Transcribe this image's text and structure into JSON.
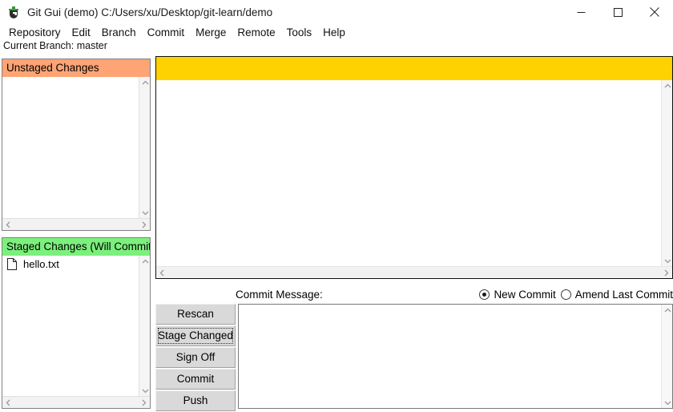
{
  "window": {
    "title": "Git Gui (demo) C:/Users/xu/Desktop/git-learn/demo",
    "icon": "git-gui-icon",
    "controls": {
      "minimize": "minimize-icon",
      "maximize": "maximize-icon",
      "close": "close-icon"
    }
  },
  "menubar": {
    "items": [
      {
        "label": "Repository"
      },
      {
        "label": "Edit"
      },
      {
        "label": "Branch"
      },
      {
        "label": "Commit"
      },
      {
        "label": "Merge"
      },
      {
        "label": "Remote"
      },
      {
        "label": "Tools"
      },
      {
        "label": "Help"
      }
    ]
  },
  "branch_bar": {
    "text": "Current Branch: master"
  },
  "unstaged": {
    "header": "Unstaged Changes",
    "header_color": "#ffa474",
    "files": []
  },
  "staged": {
    "header": "Staged Changes (Will Commit)",
    "header_color": "#7cf07c",
    "files": [
      {
        "icon": "file-icon",
        "name": "hello.txt"
      }
    ]
  },
  "diff": {
    "banner_color": "#fed100",
    "content": ""
  },
  "commit": {
    "message_label": "Commit Message:",
    "options": [
      {
        "label": "New Commit",
        "selected": true
      },
      {
        "label": "Amend Last Commit",
        "selected": false
      }
    ],
    "message_value": "",
    "message_placeholder": ""
  },
  "buttons": [
    {
      "label": "Rescan",
      "focused": false
    },
    {
      "label": "Stage Changed",
      "focused": true
    },
    {
      "label": "Sign Off",
      "focused": false
    },
    {
      "label": "Commit",
      "focused": false
    },
    {
      "label": "Push",
      "focused": false
    }
  ],
  "scrollbars": {
    "up": "scroll-up-arrow-icon",
    "down": "scroll-down-arrow-icon",
    "left": "scroll-left-arrow-icon",
    "right": "scroll-right-arrow-icon"
  }
}
